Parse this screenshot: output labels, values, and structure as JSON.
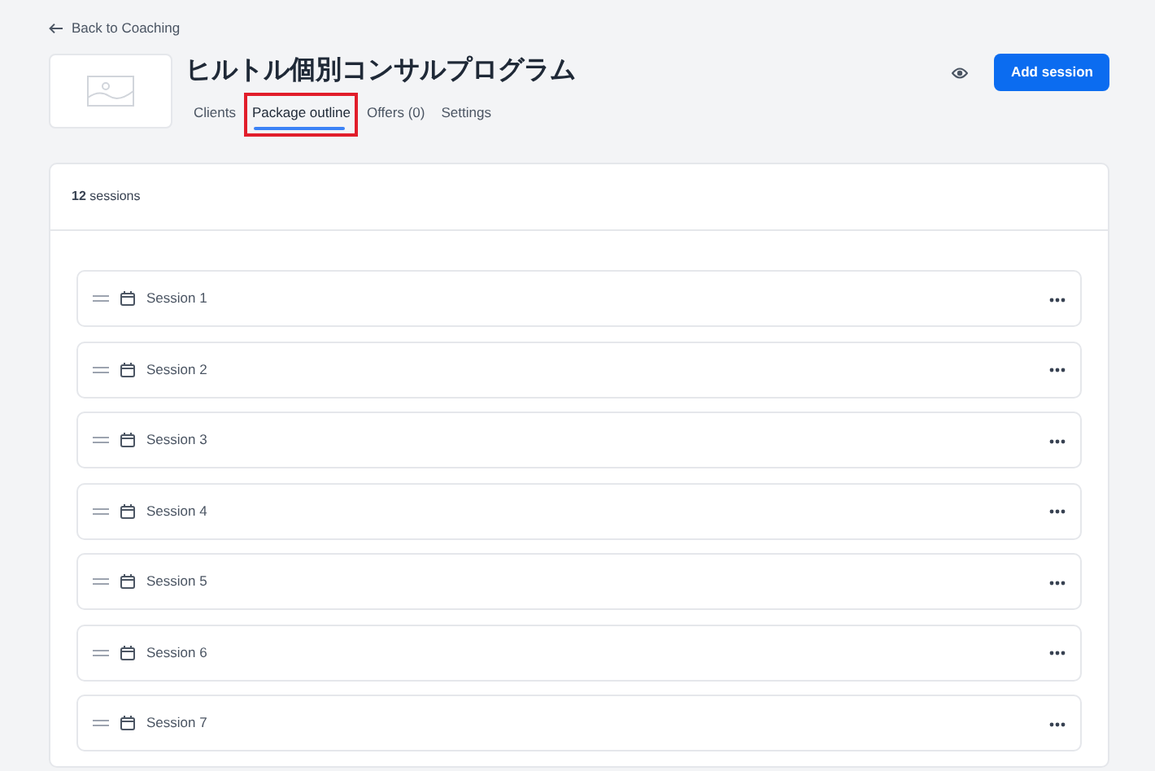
{
  "back_link": "Back to Coaching",
  "title": "ヒルトル個別コンサルプログラム",
  "tabs": [
    {
      "label": "Clients",
      "selected": false,
      "highlighted": false
    },
    {
      "label": "Package outline",
      "selected": true,
      "highlighted": true
    },
    {
      "label": "Offers (0)",
      "selected": false,
      "highlighted": false
    },
    {
      "label": "Settings",
      "selected": false,
      "highlighted": false
    }
  ],
  "add_button": "Add session",
  "session_count": {
    "number": "12",
    "unit": "sessions"
  },
  "sessions": [
    {
      "title": "Session 1"
    },
    {
      "title": "Session 2"
    },
    {
      "title": "Session 3"
    },
    {
      "title": "Session 4"
    },
    {
      "title": "Session 5"
    },
    {
      "title": "Session 6"
    },
    {
      "title": "Session 7"
    }
  ]
}
